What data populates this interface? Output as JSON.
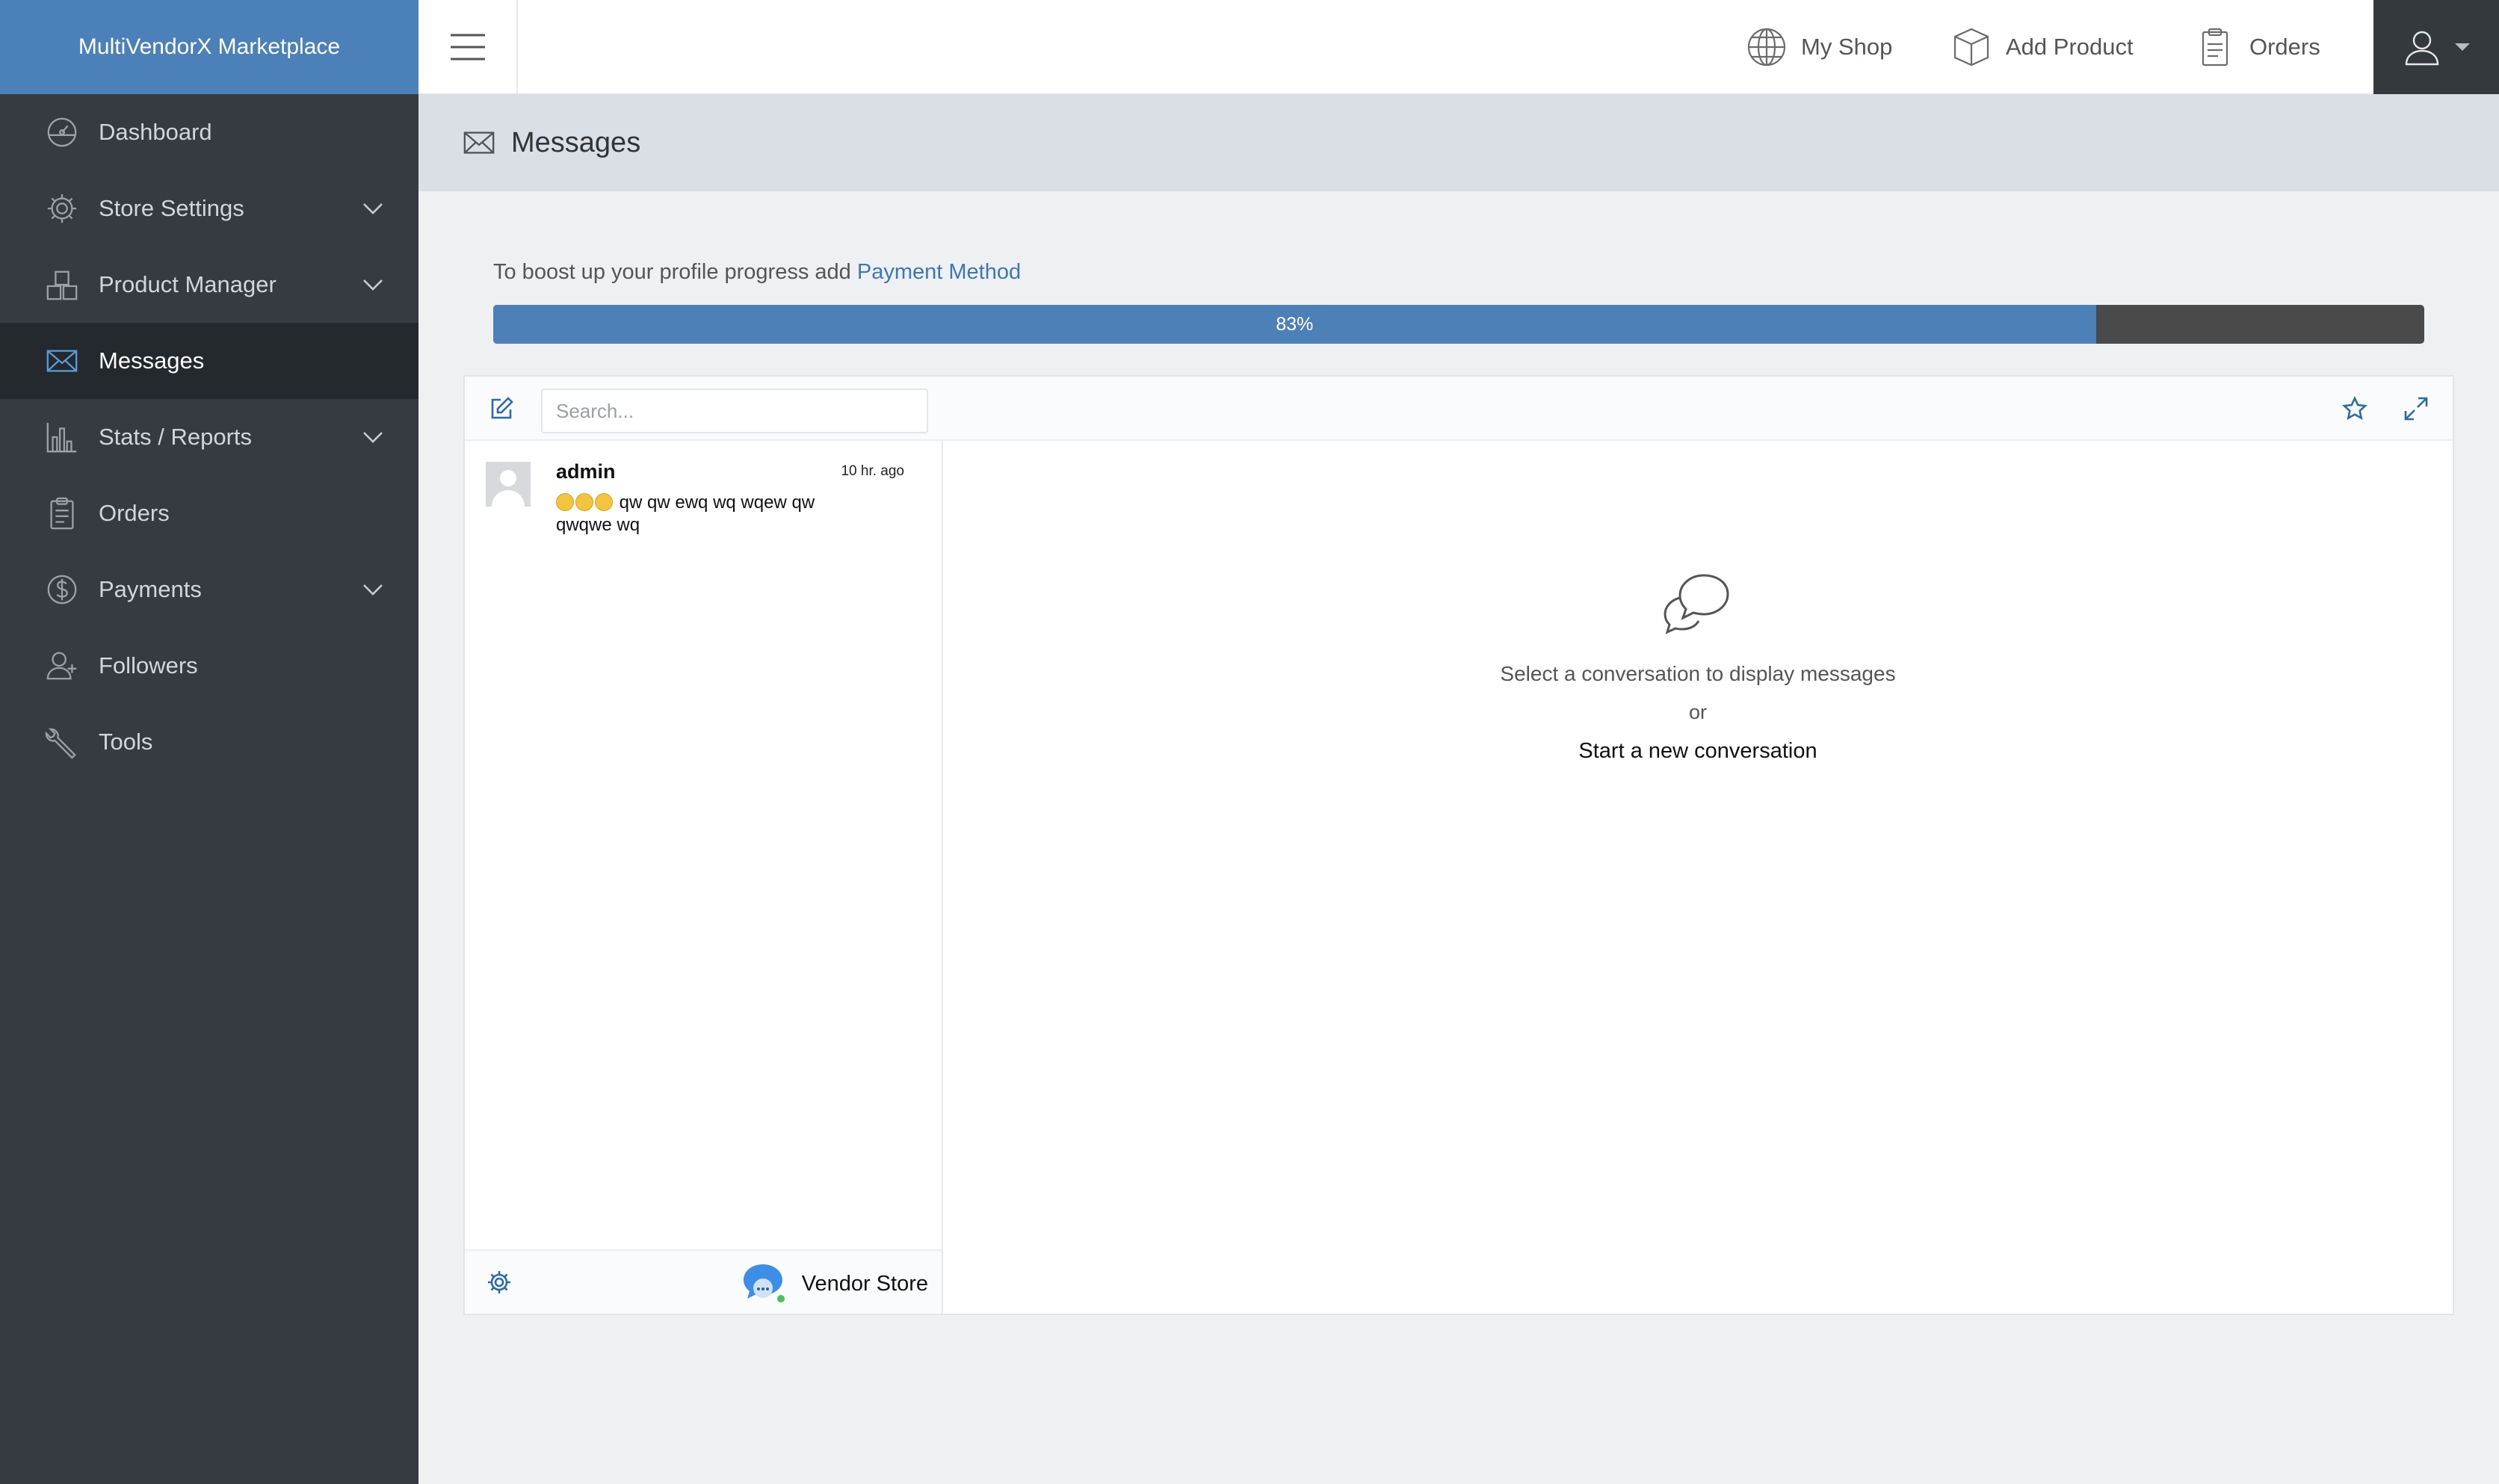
{
  "app": {
    "brand": "MultiVendorX Marketplace"
  },
  "sidebar": {
    "items": [
      {
        "label": "Dashboard",
        "icon": "dashboard-icon",
        "has_submenu": false,
        "active": false
      },
      {
        "label": "Store Settings",
        "icon": "gear-icon",
        "has_submenu": true,
        "active": false
      },
      {
        "label": "Product Manager",
        "icon": "boxes-icon",
        "has_submenu": true,
        "active": false
      },
      {
        "label": "Messages",
        "icon": "envelope-icon",
        "has_submenu": false,
        "active": true
      },
      {
        "label": "Stats / Reports",
        "icon": "bar-chart-icon",
        "has_submenu": true,
        "active": false
      },
      {
        "label": "Orders",
        "icon": "clipboard-icon",
        "has_submenu": false,
        "active": false
      },
      {
        "label": "Payments",
        "icon": "dollar-icon",
        "has_submenu": true,
        "active": false
      },
      {
        "label": "Followers",
        "icon": "user-plus-icon",
        "has_submenu": false,
        "active": false
      },
      {
        "label": "Tools",
        "icon": "wrench-icon",
        "has_submenu": false,
        "active": false
      }
    ]
  },
  "topbar": {
    "links": [
      {
        "label": "My Shop",
        "icon": "globe-icon"
      },
      {
        "label": "Add Product",
        "icon": "box-icon"
      },
      {
        "label": "Orders",
        "icon": "clipboard-icon"
      }
    ],
    "user_icon": "user-icon"
  },
  "page": {
    "title": "Messages",
    "icon": "envelope-icon"
  },
  "progress": {
    "message_prefix": "To boost up your profile progress add",
    "message_link": "Payment Method",
    "percent_label": "83%",
    "fraction": 0.83
  },
  "messenger": {
    "search_placeholder": "Search...",
    "conversations": [
      {
        "name": "admin",
        "time": "10 hr. ago",
        "emoji_count": 3,
        "preview": "qw qw ewq wq wqew qw qwqwe wq"
      }
    ],
    "footer": {
      "vendor_name": "Vendor Store"
    },
    "empty_state": {
      "select_text": "Select a conversation to display messages",
      "or_text": "or",
      "start_text": "Start a new conversation"
    }
  },
  "colors": {
    "sidebar_bg": "#353b40",
    "brand_bg": "#4b80b8",
    "active_item_bg": "#24292d",
    "progress_fill": "#4e80b8",
    "progress_track": "#4a4a4a",
    "link": "#3a78b8",
    "tool_icon": "#2f6aa6"
  }
}
